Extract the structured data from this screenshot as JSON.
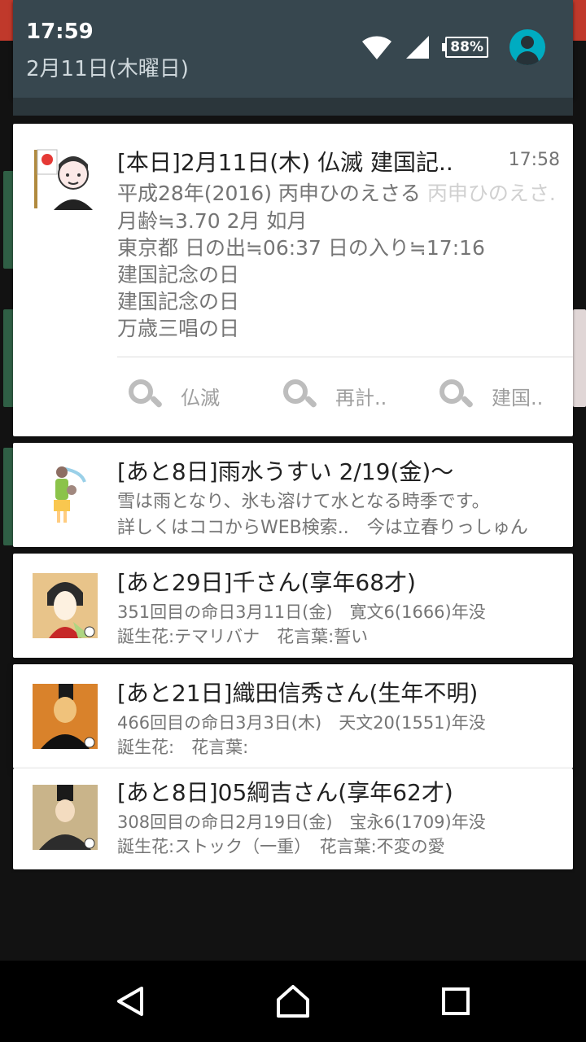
{
  "status_bar": {
    "time": "17:59",
    "date": "2月11日(木曜日)",
    "battery": "88%",
    "icons": [
      "wifi-icon",
      "cell-signal-icon",
      "battery-icon",
      "account-icon"
    ]
  },
  "notifications": [
    {
      "title": "[本日]2月11日(木) 仏滅 建国記..",
      "time": "17:58",
      "ghost_text": "平成28年(2016) 丙申ひのえさる 丙申ひのえさ..",
      "lines": [
        "平成28年(2016) 丙申ひのえさる",
        "月齢≒3.70 2月 如月",
        "東京都 日の出≒06:37 日の入り≒17:16",
        "建国記念の日",
        "建国記念の日",
        "万歳三唱の日"
      ],
      "actions": [
        "仏滅",
        "再計..",
        "建国.."
      ]
    },
    {
      "title": "[あと8日]雨水うすい 2/19(金)〜",
      "lines": [
        "雪は雨となり、氷も溶けて水となる時季です。",
        "詳しくはココからWEB検索..　今は立春りっしゅん"
      ]
    },
    {
      "title": "[あと29日]千さん(享年68才)",
      "lines": [
        "351回目の命日3月11日(金)　寛文6(1666)年没",
        " 誕生花:テマリバナ　花言葉:誓い"
      ]
    },
    {
      "title": "[あと21日]織田信秀さん(生年不明)",
      "lines": [
        "466回目の命日3月3日(木)　天文20(1551)年没",
        " 誕生花:　花言葉:"
      ]
    },
    {
      "title": "[あと8日]05綱吉さん(享年62才)",
      "lines": [
        "308回目の命日2月19日(金)　宝永6(1709)年没",
        " 誕生花:ストック（一重）　花言葉:不変の愛"
      ]
    }
  ],
  "nav": {
    "icons": [
      "back-icon",
      "home-icon",
      "recents-icon"
    ]
  },
  "colors": {
    "shade": "#37474f",
    "accent": "#00acc1",
    "card": "#ffffff"
  }
}
